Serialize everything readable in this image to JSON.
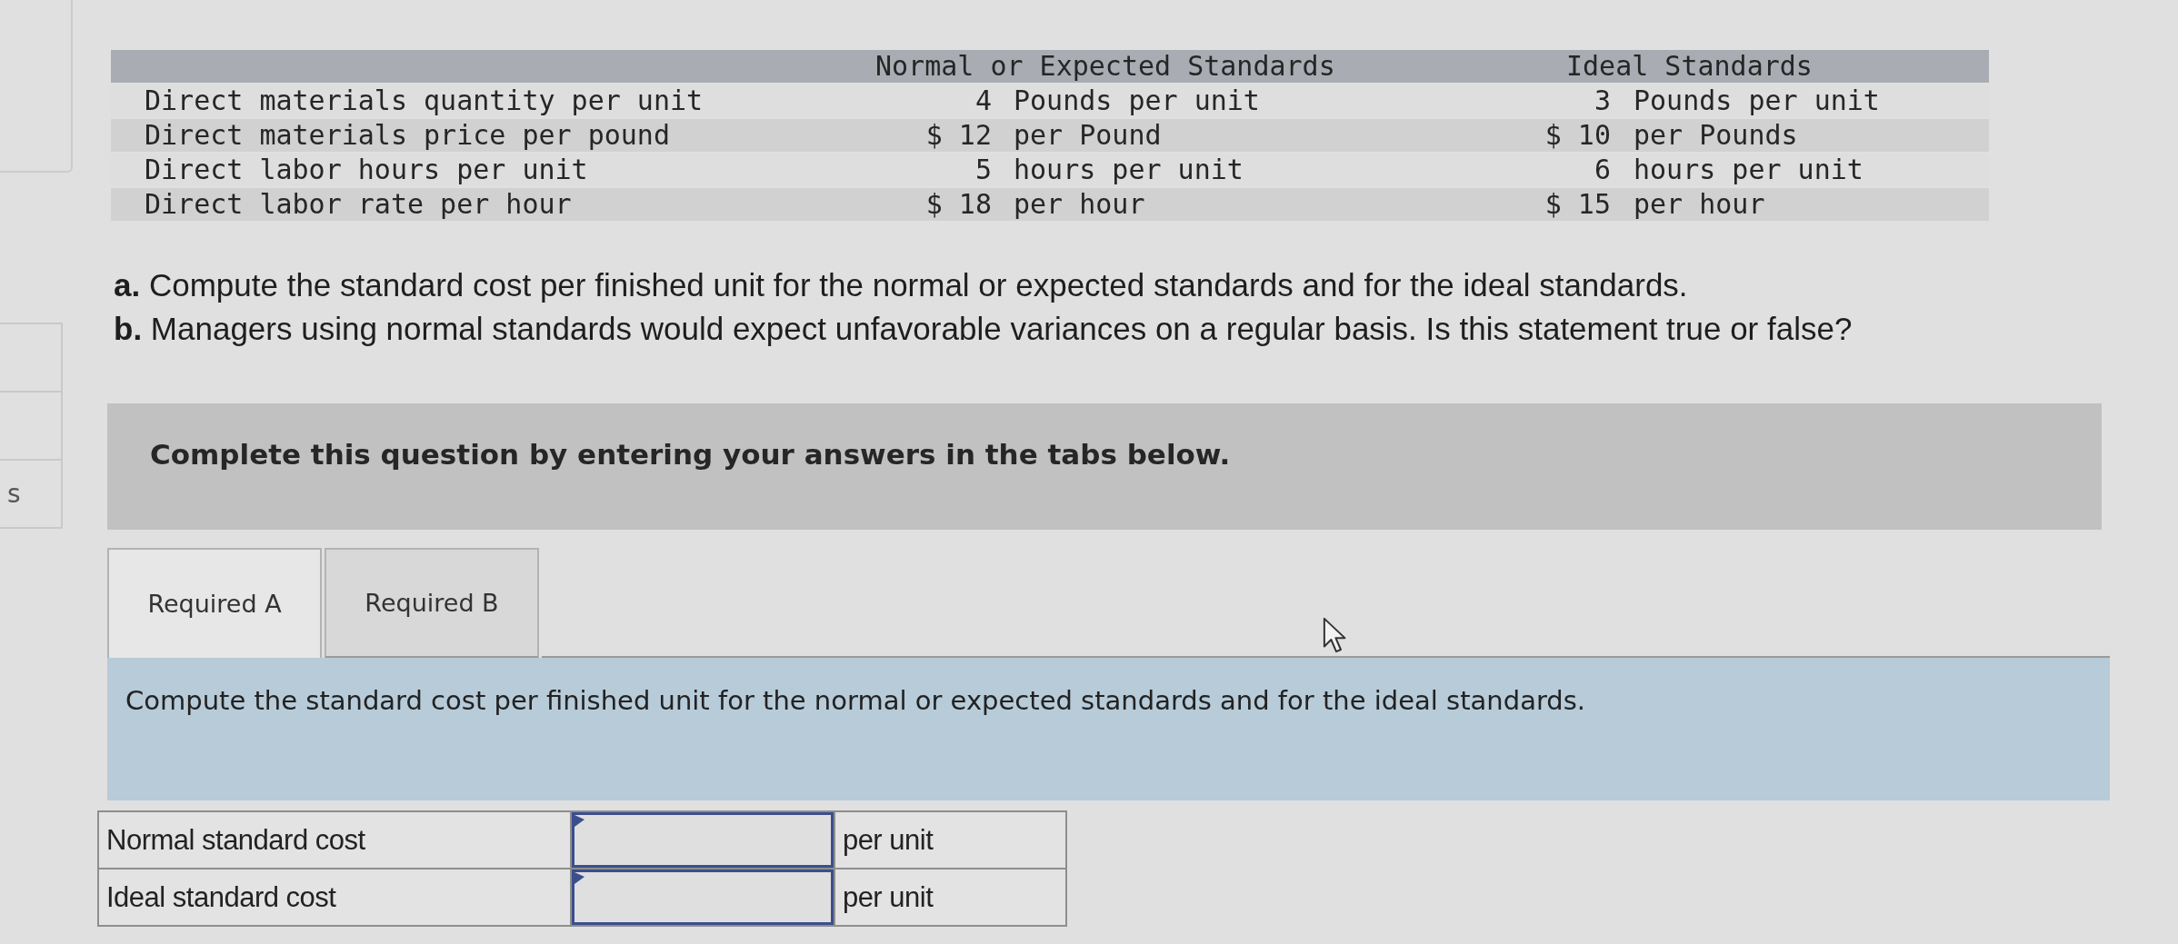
{
  "side_panel": {
    "label": "s"
  },
  "standards_table": {
    "columns": [
      "Normal or Expected Standards",
      "Ideal Standards"
    ],
    "rows": [
      {
        "label": "Direct materials quantity per unit",
        "normal_amount": "4",
        "normal_unit": "Pounds per unit",
        "ideal_amount": "3",
        "ideal_unit": "Pounds per unit"
      },
      {
        "label": "Direct materials price per pound",
        "normal_amount": "$ 12",
        "normal_unit": "per Pound",
        "ideal_amount": "$ 10",
        "ideal_unit": "per Pounds"
      },
      {
        "label": "Direct labor hours per unit",
        "normal_amount": "5",
        "normal_unit": "hours per unit",
        "ideal_amount": "6",
        "ideal_unit": "hours per unit"
      },
      {
        "label": "Direct labor rate per hour",
        "normal_amount": "$ 18",
        "normal_unit": "per hour",
        "ideal_amount": "$ 15",
        "ideal_unit": "per hour"
      }
    ]
  },
  "questions": [
    "**a.** Compute the standard cost per finished unit for the normal or expected standards and for the ideal standards.",
    "**b.** Managers using normal standards would expect unfavorable variances on a regular basis. Is this statement true or false?"
  ],
  "instruction_banner": {
    "text": "Complete this question by entering your answers in the tabs below."
  },
  "tabs": [
    {
      "label": "Required A",
      "selected": true
    },
    {
      "label": "Required B",
      "selected": false
    }
  ],
  "tab_panel": {
    "prompt": "Compute the standard cost per finished unit for the normal or expected standards and for the ideal standards."
  },
  "answer_table": {
    "rows": [
      {
        "label": "Normal standard cost",
        "unit": "per unit"
      },
      {
        "label": "Ideal standard cost",
        "unit": "per unit"
      }
    ]
  }
}
